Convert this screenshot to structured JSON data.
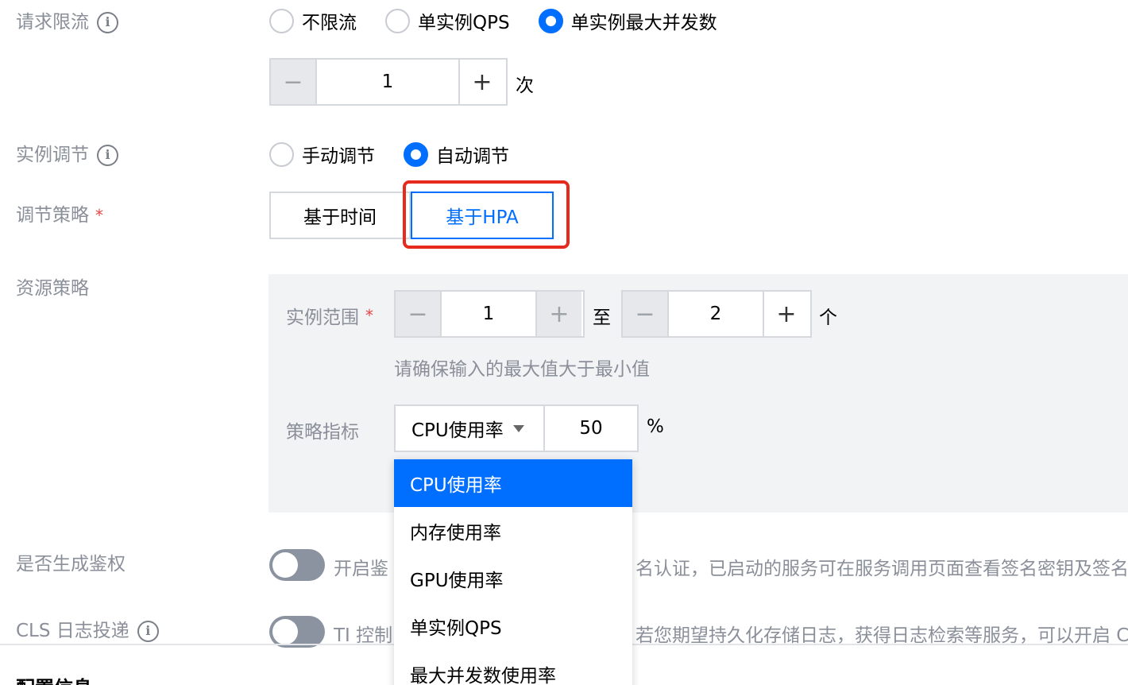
{
  "rate_limit": {
    "label": "请求限流",
    "options": [
      "不限流",
      "单实例QPS",
      "单实例最大并发数"
    ],
    "selected_index": 2,
    "stepper": {
      "minus": "−",
      "value": "1",
      "plus": "+"
    },
    "unit": "次"
  },
  "instance_adjust": {
    "label": "实例调节",
    "options": [
      "手动调节",
      "自动调节"
    ],
    "selected_index": 1
  },
  "adjust_policy": {
    "label": "调节策略",
    "required_mark": "*",
    "options": [
      "基于时间",
      "基于HPA"
    ],
    "active_index": 1
  },
  "resource_policy": {
    "label": "资源策略",
    "instance_range": {
      "label": "实例范围",
      "required_mark": "*",
      "min": {
        "minus": "−",
        "value": "1",
        "plus": "+"
      },
      "to_label": "至",
      "max": {
        "minus": "−",
        "value": "2",
        "plus": "+"
      },
      "unit": "个",
      "hint": "请确保输入的最大值大于最小值"
    },
    "metric": {
      "label": "策略指标",
      "selected": "CPU使用率",
      "value": "50",
      "unit": "%"
    }
  },
  "dropdown": {
    "items": [
      "CPU使用率",
      "内存使用率",
      "GPU使用率",
      "单实例QPS",
      "最大并发数使用率"
    ],
    "selected_index": 0
  },
  "auth": {
    "label": "是否生成鉴权",
    "desc_left": "开启鉴",
    "desc_right": "名认证，已启动的服务可在服务调用页面查看签名密钥及签名"
  },
  "cls": {
    "label": "CLS 日志投递",
    "desc_left": "TI 控制",
    "desc_right": "若您期望持久化存储日志，获得日志检索等服务，可以开启 C"
  },
  "bottom": {
    "title": "配置信息"
  },
  "colors": {
    "primary": "#006eff",
    "highlight": "#e62b1e"
  }
}
